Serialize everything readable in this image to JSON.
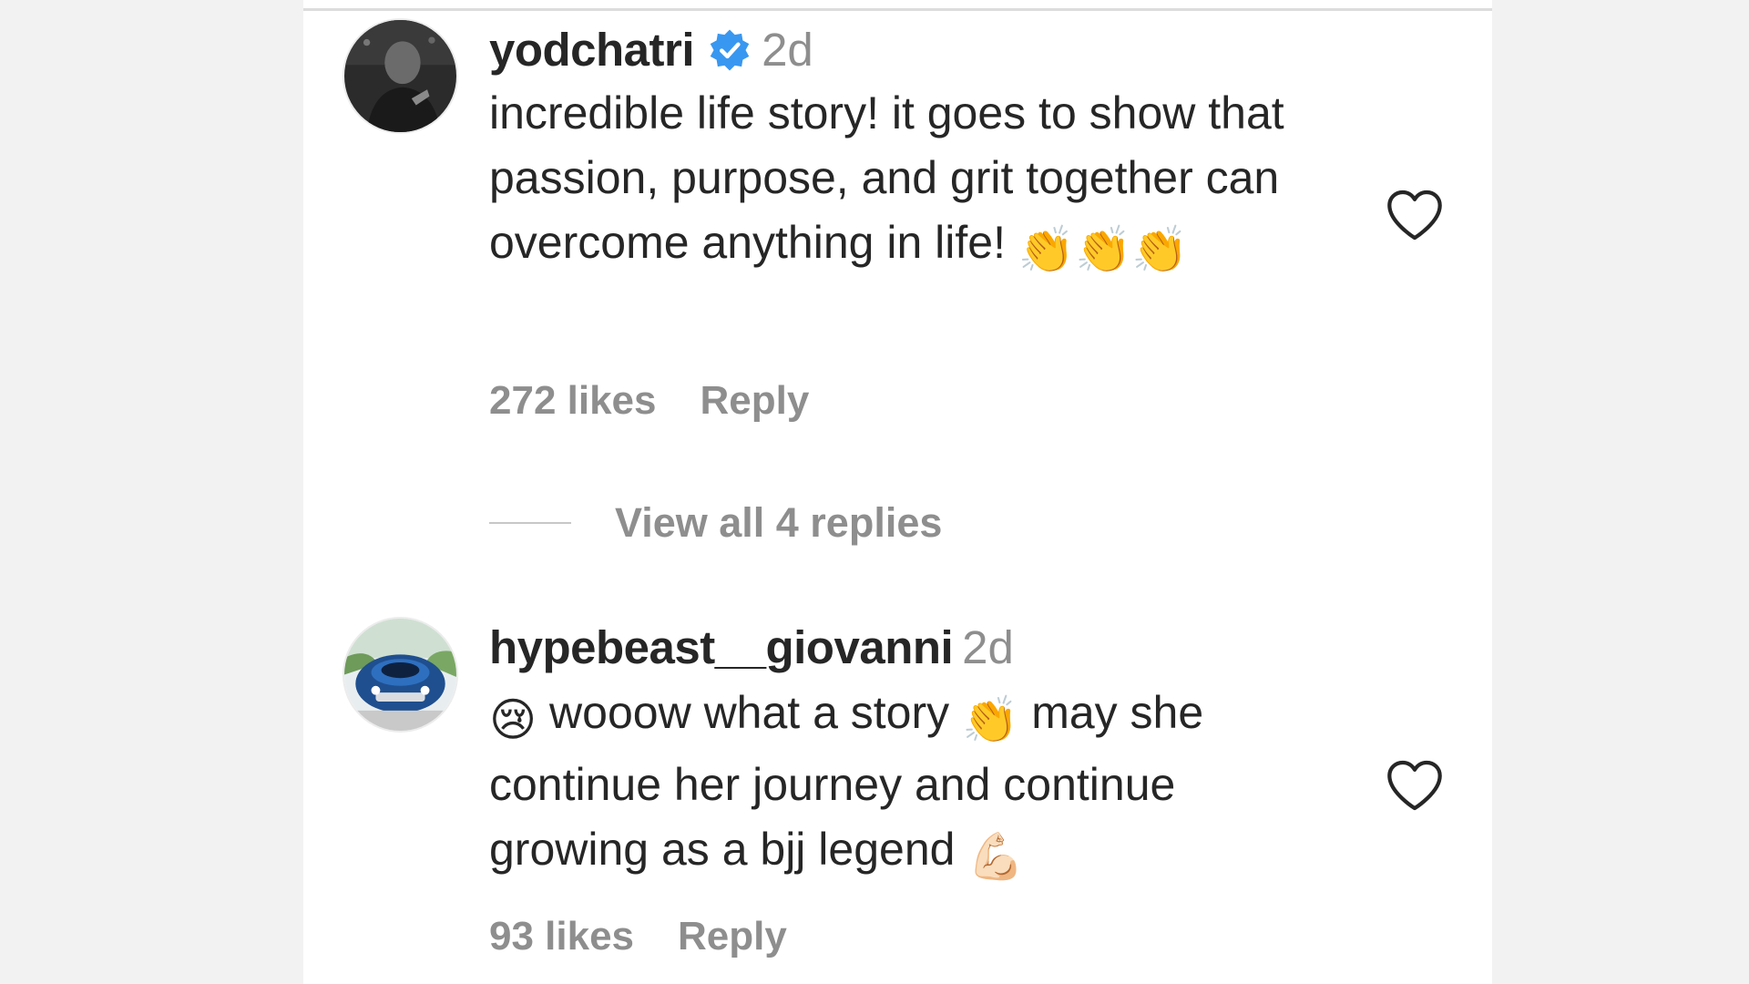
{
  "comments": [
    {
      "username": "yodchatri",
      "verified": true,
      "time": "2d",
      "text": "incredible life story! it goes to show that passion, purpose, and grit together can overcome anything in life!",
      "trailing_emojis": "👏👏👏",
      "likes": "272 likes",
      "reply_label": "Reply",
      "view_replies": "View all 4 replies"
    },
    {
      "username": "hypebeast__giovanni",
      "verified": false,
      "time": "2d",
      "lead_emoji": "😢",
      "text_part1": "wooow what a story",
      "mid_emoji": "👏",
      "text_part2": "may she continue her journey and continue growing as a bjj legend",
      "trailing_emoji": "💪🏻",
      "likes": "93 likes",
      "reply_label": "Reply"
    }
  ],
  "icons": {
    "verified": "verified-badge-icon",
    "like": "heart-outline-icon",
    "accent": "#3897f0"
  }
}
